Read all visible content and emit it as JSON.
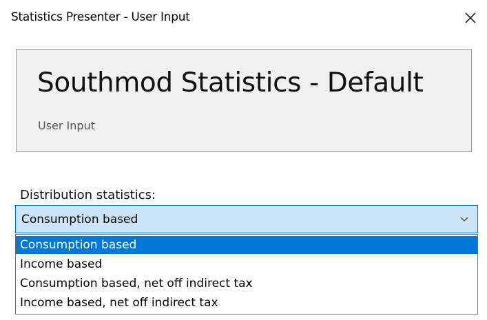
{
  "window": {
    "title": "Statistics Presenter - User Input",
    "close_icon": "close-icon"
  },
  "header": {
    "title": "Southmod Statistics - Default",
    "subtitle": "User Input"
  },
  "distribution": {
    "label": "Distribution statistics:",
    "selected_value": "Consumption based",
    "expanded": true,
    "options": [
      "Consumption based",
      "Income based",
      "Consumption based, net off indirect tax",
      "Income based, net off indirect tax"
    ],
    "highlighted_index": 0
  },
  "colors": {
    "combo_background": "#cce4f7",
    "accent": "#0078d7",
    "panel_background": "#f0f0f0"
  }
}
